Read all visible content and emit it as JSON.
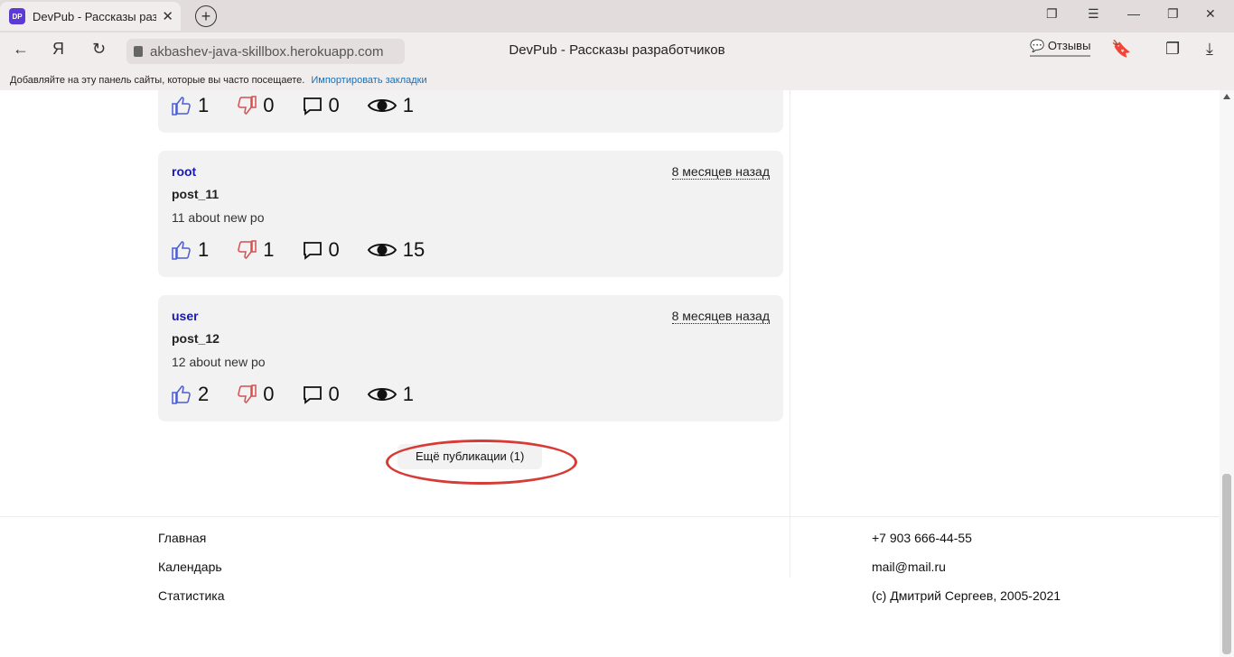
{
  "browser": {
    "tab_title": "DevPub - Рассказы разр",
    "favicon_text": "DP",
    "address": "akbashev-java-skillbox.herokuapp.com",
    "page_title": "DevPub - Рассказы разработчиков",
    "feedback_label": "Отзывы",
    "bookmarks_hint": "Добавляйте на эту панель сайты, которые вы часто посещаете.",
    "bookmarks_import": "Импортировать закладки"
  },
  "prev_card_stats": {
    "likes": "1",
    "dislikes": "0",
    "comments": "0",
    "views": "1"
  },
  "posts": [
    {
      "author": "root",
      "time": "8 месяцев назад",
      "title": "post_11",
      "excerpt": "11 about new po",
      "likes": "1",
      "dislikes": "1",
      "comments": "0",
      "views": "15"
    },
    {
      "author": "user",
      "time": "8 месяцев назад",
      "title": "post_12",
      "excerpt": "12 about new po",
      "likes": "2",
      "dislikes": "0",
      "comments": "0",
      "views": "1"
    }
  ],
  "more_button": "Ещё публикации (1)",
  "footer": {
    "links": [
      "Главная",
      "Календарь",
      "Статистика"
    ],
    "phone": "+7 903 666-44-55",
    "email": "mail@mail.ru",
    "copyright": "(c) Дмитрий Сергеев, 2005-2021"
  },
  "colors": {
    "author": "#1a1aaa",
    "like": "#4a5bd4",
    "dislike": "#d65050",
    "highlight": "#d63b35"
  }
}
